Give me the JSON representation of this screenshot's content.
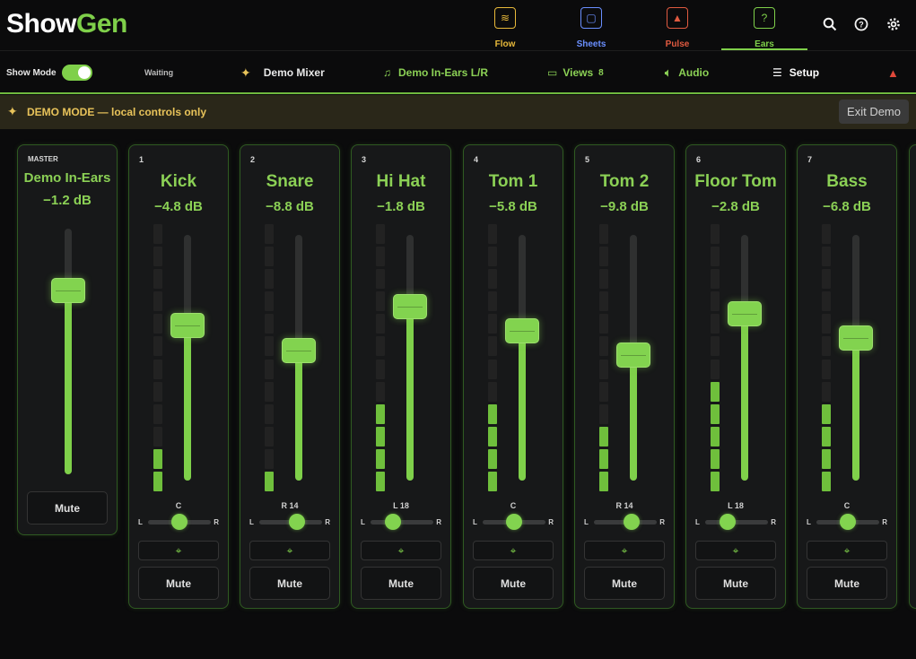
{
  "app": {
    "logo_part1": "Show",
    "logo_part2": "Gen"
  },
  "nav_tabs": [
    {
      "label": "Flow",
      "color": "#e8b93a",
      "glyph": "≋"
    },
    {
      "label": "Sheets",
      "color": "#6a8fff",
      "glyph": "▢"
    },
    {
      "label": "Pulse",
      "color": "#e05a40",
      "glyph": "▲"
    },
    {
      "label": "Ears",
      "color": "#7fd04a",
      "glyph": "?"
    }
  ],
  "toolbar": {
    "show_mode_label": "Show Mode",
    "status": "Waiting",
    "mixer_label": "Demo Mixer",
    "ears_label": "Demo In-Ears L/R",
    "views_label": "Views",
    "views_count": "8",
    "audio_label": "Audio",
    "setup_label": "Setup"
  },
  "banner": {
    "text": "DEMO MODE — local controls only",
    "exit_label": "Exit Demo"
  },
  "master": {
    "tag": "MASTER",
    "name": "Demo In-Ears",
    "db": "−1.2 dB",
    "level": 0.75,
    "mute_label": "Mute"
  },
  "channels": [
    {
      "num": "1",
      "name": "Kick",
      "db": "−4.8 dB",
      "level": 0.63,
      "meter_on": 2,
      "pan_label": "C",
      "pan": 0.5,
      "mute_label": "Mute"
    },
    {
      "num": "2",
      "name": "Snare",
      "db": "−8.8 dB",
      "level": 0.53,
      "meter_on": 1,
      "pan_label": "R 14",
      "pan": 0.6,
      "mute_label": "Mute"
    },
    {
      "num": "3",
      "name": "Hi Hat",
      "db": "−1.8 dB",
      "level": 0.71,
      "meter_on": 4,
      "pan_label": "L 18",
      "pan": 0.36,
      "mute_label": "Mute"
    },
    {
      "num": "4",
      "name": "Tom 1",
      "db": "−5.8 dB",
      "level": 0.61,
      "meter_on": 4,
      "pan_label": "C",
      "pan": 0.5,
      "mute_label": "Mute"
    },
    {
      "num": "5",
      "name": "Tom 2",
      "db": "−9.8 dB",
      "level": 0.51,
      "meter_on": 3,
      "pan_label": "R 14",
      "pan": 0.6,
      "mute_label": "Mute"
    },
    {
      "num": "6",
      "name": "Floor Tom",
      "db": "−2.8 dB",
      "level": 0.68,
      "meter_on": 5,
      "pan_label": "L 18",
      "pan": 0.36,
      "mute_label": "Mute"
    },
    {
      "num": "7",
      "name": "Bass",
      "db": "−6.8 dB",
      "level": 0.58,
      "meter_on": 4,
      "pan_label": "C",
      "pan": 0.5,
      "mute_label": "Mute"
    }
  ],
  "pan_left": "L",
  "pan_right": "R"
}
